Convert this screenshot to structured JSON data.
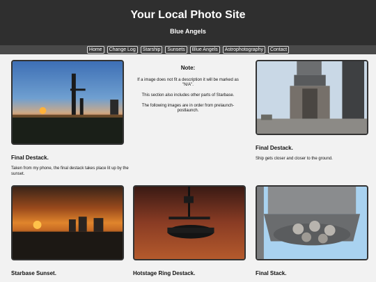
{
  "site": {
    "title": "Your Local Photo Site",
    "subtitle": "Blue Angels"
  },
  "nav": [
    "Home",
    "Change Log",
    "Starship",
    "Sunsets",
    "Blue Angels",
    "Astrophotography",
    "Contact"
  ],
  "note": {
    "title": "Note:",
    "lines": [
      "If a image does not fit a description it will be marked as \"N/A\".",
      "This section also includes other parts of Starbase.",
      "The following images are in order from prelaunch-postlaunch."
    ]
  },
  "cards": [
    {
      "title": "Final Destack.",
      "description": "Taken from my phone, the final destack takes place lit up by the sunset."
    },
    {
      "title": "Final Destack.",
      "description": "Ship gets closer and closer to the ground."
    },
    {
      "title": "Starbase Sunset.",
      "description": ""
    },
    {
      "title": "Hotstage Ring Destack.",
      "description": ""
    },
    {
      "title": "Final Stack.",
      "description": ""
    }
  ]
}
